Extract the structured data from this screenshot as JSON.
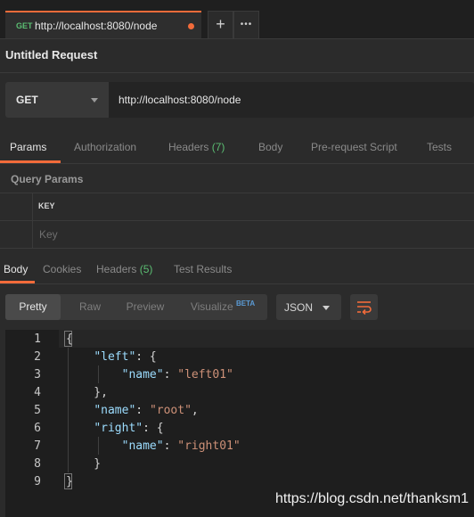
{
  "tab": {
    "method": "GET",
    "url": "http://localhost:8080/node",
    "add_label": "+",
    "more_label": "•••"
  },
  "request": {
    "title": "Untitled Request",
    "method": "GET",
    "url": "http://localhost:8080/node"
  },
  "request_tabs": [
    {
      "label": "Params",
      "count": ""
    },
    {
      "label": "Authorization",
      "count": ""
    },
    {
      "label": "Headers",
      "count": "(7)"
    },
    {
      "label": "Body",
      "count": ""
    },
    {
      "label": "Pre-request Script",
      "count": ""
    },
    {
      "label": "Tests",
      "count": ""
    }
  ],
  "query_params": {
    "label": "Query Params",
    "column_key": "KEY",
    "key_placeholder": "Key"
  },
  "response_tabs": [
    {
      "label": "Body",
      "count": ""
    },
    {
      "label": "Cookies",
      "count": ""
    },
    {
      "label": "Headers",
      "count": "(5)"
    },
    {
      "label": "Test Results",
      "count": ""
    }
  ],
  "view_modes": [
    "Pretty",
    "Raw",
    "Preview",
    "Visualize"
  ],
  "beta_badge": "BETA",
  "format": "JSON",
  "code_lines": [
    "{",
    "    \"left\": {",
    "        \"name\": \"left01\"",
    "    },",
    "    \"name\": \"root\",",
    "    \"right\": {",
    "        \"name\": \"right01\"",
    "    }",
    "}"
  ],
  "line_numbers": [
    "1",
    "2",
    "3",
    "4",
    "5",
    "6",
    "7",
    "8",
    "9"
  ],
  "watermark": "https://blog.csdn.net/thanksm1",
  "colors": {
    "accent": "#f26b3a",
    "method_green": "#5bbd72",
    "json_key": "#9cdcfe",
    "json_string": "#ce9178"
  }
}
